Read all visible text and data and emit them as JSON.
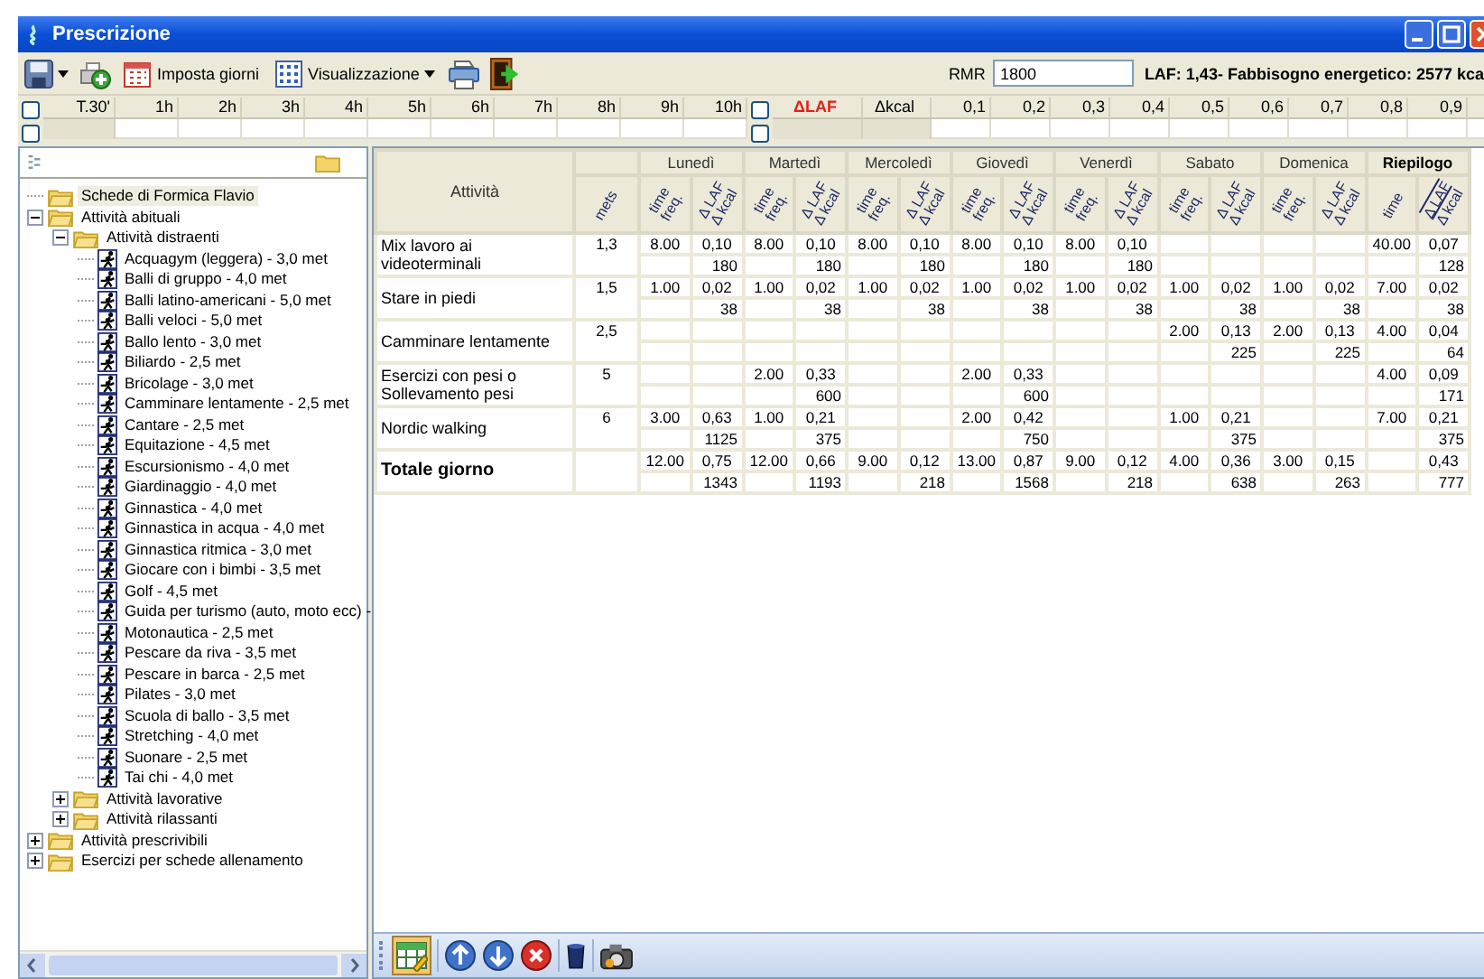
{
  "window": {
    "title": "Prescrizione"
  },
  "toolbar": {
    "set_days": "Imposta giorni",
    "view": "Visualizzazione",
    "rmr_label": "RMR",
    "rmr_value": "1800",
    "summary": "LAF: 1,43- Fabbisogno energetico: 2577 kca"
  },
  "time_strip": {
    "row_checks": [
      {
        "checked": false
      },
      {
        "checked": false
      }
    ],
    "first": "T.30'",
    "hours": [
      "1h",
      "2h",
      "3h",
      "4h",
      "5h",
      "6h",
      "7h",
      "8h",
      "9h",
      "10h"
    ],
    "delta_checks": [
      {
        "checked": false
      },
      {
        "checked": false
      }
    ],
    "delta_laf": "ΔLAF",
    "delta_kcal": "Δkcal",
    "levels": [
      "0,1",
      "0,2",
      "0,3",
      "0,4",
      "0,5",
      "0,6",
      "0,7",
      "0,8",
      "0,9"
    ]
  },
  "tree": [
    {
      "label": "Schede di Formica Flavio",
      "kind": "folder",
      "selected": true
    },
    {
      "label": "Attività abituali",
      "kind": "folder",
      "selected": false,
      "expanded": true,
      "children": [
        {
          "label": "Attività distraenti",
          "kind": "folder",
          "selected": false,
          "expanded": true,
          "children": [
            {
              "label": "Acquagym (leggera)  -  3,0 met",
              "kind": "activity",
              "selected": false
            },
            {
              "label": "Balli di gruppo  -  4,0 met",
              "kind": "activity",
              "selected": false
            },
            {
              "label": "Balli latino-americani  -  5,0 met",
              "kind": "activity",
              "selected": false
            },
            {
              "label": "Balli veloci  -  5,0 met",
              "kind": "activity",
              "selected": false
            },
            {
              "label": "Ballo lento  -  3,0 met",
              "kind": "activity",
              "selected": false
            },
            {
              "label": "Biliardo  -  2,5 met",
              "kind": "activity",
              "selected": false
            },
            {
              "label": "Bricolage  -  3,0 met",
              "kind": "activity",
              "selected": false
            },
            {
              "label": "Camminare lentamente  -  2,5 met",
              "kind": "activity",
              "selected": false
            },
            {
              "label": "Cantare  -  2,5 met",
              "kind": "activity",
              "selected": false
            },
            {
              "label": "Equitazione  -  4,5 met",
              "kind": "activity",
              "selected": false
            },
            {
              "label": "Escursionismo  -  4,0 met",
              "kind": "activity",
              "selected": false
            },
            {
              "label": "Giardinaggio  -  4,0 met",
              "kind": "activity",
              "selected": false
            },
            {
              "label": "Ginnastica  -  4,0 met",
              "kind": "activity",
              "selected": false
            },
            {
              "label": "Ginnastica in acqua  -  4,0 met",
              "kind": "activity",
              "selected": false
            },
            {
              "label": "Ginnastica ritmica  -  3,0 met",
              "kind": "activity",
              "selected": false
            },
            {
              "label": "Giocare con i bimbi  -  3,5 met",
              "kind": "activity",
              "selected": false
            },
            {
              "label": "Golf  -  4,5 met",
              "kind": "activity",
              "selected": false
            },
            {
              "label": "Guida per turismo (auto, moto ecc)  -",
              "kind": "activity",
              "selected": false
            },
            {
              "label": "Motonautica  -  2,5 met",
              "kind": "activity",
              "selected": false
            },
            {
              "label": "Pescare da riva  -  3,5 met",
              "kind": "activity",
              "selected": false
            },
            {
              "label": "Pescare in barca  -  2,5 met",
              "kind": "activity",
              "selected": false
            },
            {
              "label": "Pilates  -  3,0 met",
              "kind": "activity",
              "selected": false
            },
            {
              "label": "Scuola di ballo  -  3,5 met",
              "kind": "activity",
              "selected": false
            },
            {
              "label": "Stretching  -  4,0 met",
              "kind": "activity",
              "selected": false
            },
            {
              "label": "Suonare  -  2,5 met",
              "kind": "activity",
              "selected": false
            },
            {
              "label": "Tai chi  -  4,0 met",
              "kind": "activity",
              "selected": false
            }
          ]
        },
        {
          "label": "Attività lavorative",
          "kind": "folder",
          "selected": false,
          "expanded": false
        },
        {
          "label": "Attività rilassanti",
          "kind": "folder",
          "selected": false,
          "expanded": false
        }
      ]
    },
    {
      "label": "Attività prescrivibili",
      "kind": "folder",
      "selected": false,
      "expanded": false
    },
    {
      "label": "Esercizi per schede allenamento",
      "kind": "folder",
      "selected": false,
      "expanded": false
    }
  ],
  "table": {
    "activity_header": "Attività",
    "mets_header": "mets",
    "days": [
      {
        "name": "Lunedì",
        "time_label": "time freq.",
        "delta_label": "Δ LAF Δ kcal"
      },
      {
        "name": "Martedì",
        "time_label": "time freq.",
        "delta_label": "Δ LAF Δ kcal"
      },
      {
        "name": "Mercoledì",
        "time_label": "time freq.",
        "delta_label": "Δ LAF Δ kcal"
      },
      {
        "name": "Giovedì",
        "time_label": "time freq.",
        "delta_label": "Δ LAF Δ kcal"
      },
      {
        "name": "Venerdì",
        "time_label": "time freq.",
        "delta_label": "Δ LAF Δ kcal"
      },
      {
        "name": "Sabato",
        "time_label": "time freq.",
        "delta_label": "Δ LAF Δ kcal"
      },
      {
        "name": "Domenica",
        "time_label": "time freq.",
        "delta_label": "Δ LAF Δ kcal"
      },
      {
        "name": "Riepilogo",
        "time_label": "time",
        "delta_label": "Δ LAF Δ kcal",
        "kind": "summary"
      }
    ],
    "rows": [
      {
        "kind": "activity",
        "activity": "Mix lavoro ai videoterminali",
        "mets": "1,3",
        "cells": [
          {
            "time": "8.00",
            "laf": "0,10",
            "kcal": "180"
          },
          {
            "time": "8.00",
            "laf": "0,10",
            "kcal": "180"
          },
          {
            "time": "8.00",
            "laf": "0,10",
            "kcal": "180"
          },
          {
            "time": "8.00",
            "laf": "0,10",
            "kcal": "180"
          },
          {
            "time": "8.00",
            "laf": "0,10",
            "kcal": "180"
          },
          {},
          {},
          {
            "time": "40.00",
            "laf": "0,07",
            "kcal": "128"
          }
        ]
      },
      {
        "kind": "activity",
        "activity": "Stare in piedi",
        "mets": "1,5",
        "cells": [
          {
            "time": "1.00",
            "laf": "0,02",
            "kcal": "38"
          },
          {
            "time": "1.00",
            "laf": "0,02",
            "kcal": "38"
          },
          {
            "time": "1.00",
            "laf": "0,02",
            "kcal": "38"
          },
          {
            "time": "1.00",
            "laf": "0,02",
            "kcal": "38"
          },
          {
            "time": "1.00",
            "laf": "0,02",
            "kcal": "38"
          },
          {
            "time": "1.00",
            "laf": "0,02",
            "kcal": "38"
          },
          {
            "time": "1.00",
            "laf": "0,02",
            "kcal": "38"
          },
          {
            "time": "7.00",
            "laf": "0,02",
            "kcal": "38"
          }
        ]
      },
      {
        "kind": "activity",
        "activity": "Camminare lentamente",
        "mets": "2,5",
        "cells": [
          {},
          {},
          {},
          {},
          {},
          {
            "time": "2.00",
            "laf": "0,13",
            "kcal": "225"
          },
          {
            "time": "2.00",
            "laf": "0,13",
            "kcal": "225"
          },
          {
            "time": "4.00",
            "laf": "0,04",
            "kcal": "64"
          }
        ]
      },
      {
        "kind": "activity",
        "activity": "Esercizi con pesi o Sollevamento pesi",
        "mets": "5",
        "cells": [
          {},
          {
            "time": "2.00",
            "laf": "0,33",
            "kcal": "600"
          },
          {},
          {
            "time": "2.00",
            "laf": "0,33",
            "kcal": "600"
          },
          {},
          {},
          {},
          {
            "time": "4.00",
            "laf": "0,09",
            "kcal": "171"
          }
        ]
      },
      {
        "kind": "activity",
        "activity": "Nordic walking",
        "mets": "6",
        "cells": [
          {
            "time": "3.00",
            "laf": "0,63",
            "kcal": "1125"
          },
          {
            "time": "1.00",
            "laf": "0,21",
            "kcal": "375"
          },
          {},
          {
            "time": "2.00",
            "laf": "0,42",
            "kcal": "750"
          },
          {},
          {
            "time": "1.00",
            "laf": "0,21",
            "kcal": "375"
          },
          {},
          {
            "time": "7.00",
            "laf": "0,21",
            "kcal": "375"
          }
        ]
      },
      {
        "kind": "total",
        "activity": "Totale giorno",
        "cells": [
          {
            "time": "12.00",
            "laf": "0,75",
            "kcal": "1343"
          },
          {
            "time": "12.00",
            "laf": "0,66",
            "kcal": "1193"
          },
          {
            "time": "9.00",
            "laf": "0,12",
            "kcal": "218"
          },
          {
            "time": "13.00",
            "laf": "0,87",
            "kcal": "1568"
          },
          {
            "time": "9.00",
            "laf": "0,12",
            "kcal": "218"
          },
          {
            "time": "4.00",
            "laf": "0,36",
            "kcal": "638"
          },
          {
            "time": "3.00",
            "laf": "0,15",
            "kcal": "263"
          },
          {
            "laf": "0,43",
            "kcal": "777"
          }
        ]
      }
    ]
  }
}
